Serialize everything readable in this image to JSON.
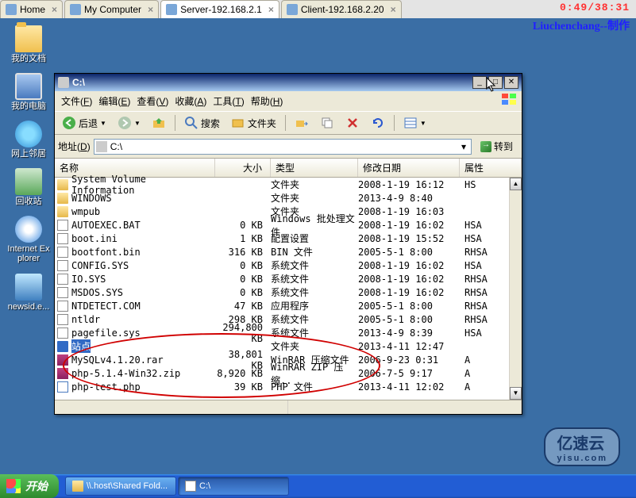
{
  "clock": "0:49/38:31",
  "brand": "Liuchenchang--制作",
  "vm_tabs": [
    {
      "label": "Home",
      "icon": "home",
      "active": false
    },
    {
      "label": "My Computer",
      "icon": "computer",
      "active": false
    },
    {
      "label": "Server-192.168.2.1",
      "icon": "server",
      "active": true
    },
    {
      "label": "Client-192.168.2.20",
      "icon": "client",
      "active": false
    }
  ],
  "desktop_icons": [
    {
      "label": "我的文档",
      "icon": "ic-folder-open"
    },
    {
      "label": "我的电脑",
      "icon": "ic-computer"
    },
    {
      "label": "网上邻居",
      "icon": "ic-net"
    },
    {
      "label": "回收站",
      "icon": "ic-recycle"
    },
    {
      "label": "Internet Explorer",
      "icon": "ic-ie"
    },
    {
      "label": "newsid.e...",
      "icon": "ic-newsid"
    }
  ],
  "window": {
    "title": "C:\\",
    "menu": [
      {
        "label": "文件",
        "key": "F"
      },
      {
        "label": "编辑",
        "key": "E"
      },
      {
        "label": "查看",
        "key": "V"
      },
      {
        "label": "收藏",
        "key": "A"
      },
      {
        "label": "工具",
        "key": "T"
      },
      {
        "label": "帮助",
        "key": "H"
      }
    ],
    "toolbar": {
      "back": "后退",
      "search": "搜索",
      "folders": "文件夹"
    },
    "addr_label": "地址",
    "addr_key": "D",
    "addr_value": "C:\\",
    "go_label": "转到",
    "columns": {
      "name": "名称",
      "size": "大小",
      "type": "类型",
      "date": "修改日期",
      "attr": "属性"
    },
    "files": [
      {
        "name": "System Volume Information",
        "size": "",
        "type": "文件夹",
        "date": "2008-1-19 16:12",
        "attr": "HS",
        "fi": "fi-folder"
      },
      {
        "name": "WINDOWS",
        "size": "",
        "type": "文件夹",
        "date": "2013-4-9 8:40",
        "attr": "",
        "fi": "fi-folder"
      },
      {
        "name": "wmpub",
        "size": "",
        "type": "文件夹",
        "date": "2008-1-19 16:03",
        "attr": "",
        "fi": "fi-folder"
      },
      {
        "name": "AUTOEXEC.BAT",
        "size": "0 KB",
        "type": "Windows 批处理文件",
        "date": "2008-1-19 16:02",
        "attr": "HSA",
        "fi": "fi-bat"
      },
      {
        "name": "boot.ini",
        "size": "1 KB",
        "type": "配置设置",
        "date": "2008-1-19 15:52",
        "attr": "HSA",
        "fi": "fi-ini"
      },
      {
        "name": "bootfont.bin",
        "size": "316 KB",
        "type": "BIN 文件",
        "date": "2005-5-1 8:00",
        "attr": "RHSA",
        "fi": "fi-bin"
      },
      {
        "name": "CONFIG.SYS",
        "size": "0 KB",
        "type": "系统文件",
        "date": "2008-1-19 16:02",
        "attr": "HSA",
        "fi": "fi-sys"
      },
      {
        "name": "IO.SYS",
        "size": "0 KB",
        "type": "系统文件",
        "date": "2008-1-19 16:02",
        "attr": "RHSA",
        "fi": "fi-sys"
      },
      {
        "name": "MSDOS.SYS",
        "size": "0 KB",
        "type": "系统文件",
        "date": "2008-1-19 16:02",
        "attr": "RHSA",
        "fi": "fi-sys"
      },
      {
        "name": "NTDETECT.COM",
        "size": "47 KB",
        "type": "应用程序",
        "date": "2005-5-1 8:00",
        "attr": "RHSA",
        "fi": "fi-com"
      },
      {
        "name": "ntldr",
        "size": "298 KB",
        "type": "系统文件",
        "date": "2005-5-1 8:00",
        "attr": "RHSA",
        "fi": "fi-file"
      },
      {
        "name": "pagefile.sys",
        "size": "294,800 KB",
        "type": "系统文件",
        "date": "2013-4-9 8:39",
        "attr": "HSA",
        "fi": "fi-sys"
      },
      {
        "name": "站点",
        "size": "",
        "type": "文件夹",
        "date": "2013-4-11 12:47",
        "attr": "",
        "fi": "fi-folder",
        "sel": true
      },
      {
        "name": "MySQLv4.1.20.rar",
        "size": "38,801 KB",
        "type": "WinRAR 压缩文件",
        "date": "2006-9-23 0:31",
        "attr": "A",
        "fi": "fi-rar"
      },
      {
        "name": "php-5.1.4-Win32.zip",
        "size": "8,920 KB",
        "type": "WinRAR ZIP 压缩..",
        "date": "2006-7-5 9:17",
        "attr": "A",
        "fi": "fi-zip"
      },
      {
        "name": "php-test.php",
        "size": "39 KB",
        "type": "PHP 文件",
        "date": "2013-4-11 12:02",
        "attr": "A",
        "fi": "fi-php"
      }
    ]
  },
  "taskbar": {
    "start": "开始",
    "tasks": [
      {
        "label": "\\\\.host\\Shared Fold...",
        "icon": "fi-folder",
        "active": false
      },
      {
        "label": "C:\\",
        "icon": "drive",
        "active": true
      }
    ]
  },
  "watermark": {
    "big": "亿速云",
    "small": "yisu.com"
  }
}
